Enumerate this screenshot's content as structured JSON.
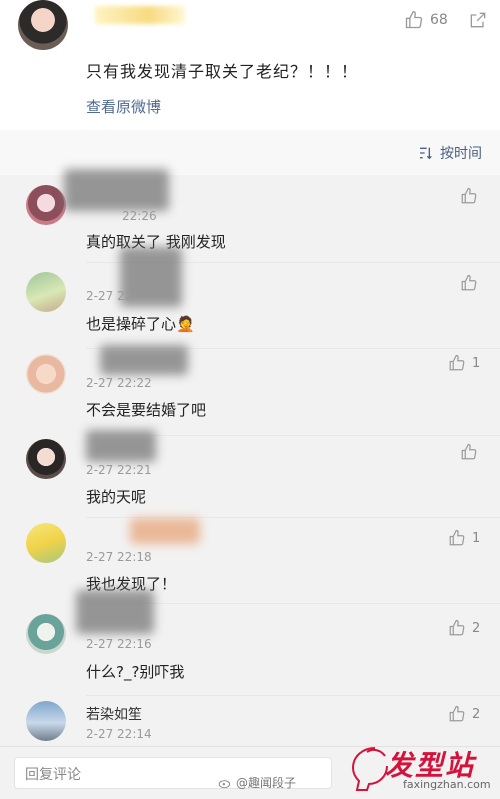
{
  "post": {
    "likes": "68",
    "text": "只有我发现清子取关了老纪？！！！",
    "view_original": "查看原微博"
  },
  "sort": {
    "label": "按时间"
  },
  "comments": [
    {
      "name": "",
      "time": "22:26",
      "text": "真的取关了 我刚发现",
      "likes": ""
    },
    {
      "name": "",
      "time": "2-27 22:",
      "text": "也是操碎了心🤦",
      "likes": ""
    },
    {
      "name": "",
      "time": "2-27 22:22",
      "text": "不会是要结婚了吧",
      "likes": "1"
    },
    {
      "name": "",
      "time": "2-27 22:21",
      "text": "我的天呢",
      "likes": ""
    },
    {
      "name": "",
      "time": "2-27 22:18",
      "text": "我也发现了！",
      "likes": "1"
    },
    {
      "name": "",
      "time": "2-27 22:16",
      "text": "什么?_?别吓我",
      "likes": "2"
    },
    {
      "name": "若染如笙",
      "time": "2-27 22:14",
      "text": "",
      "likes": "2"
    }
  ],
  "reply": {
    "placeholder": "回复评论"
  },
  "watermark": {
    "weibo": "@趣闻段子",
    "site_cn": "发型站",
    "site_url": "faxingzhan.com"
  },
  "colors": {
    "link": "#506a93",
    "brand": "#d4133d"
  }
}
